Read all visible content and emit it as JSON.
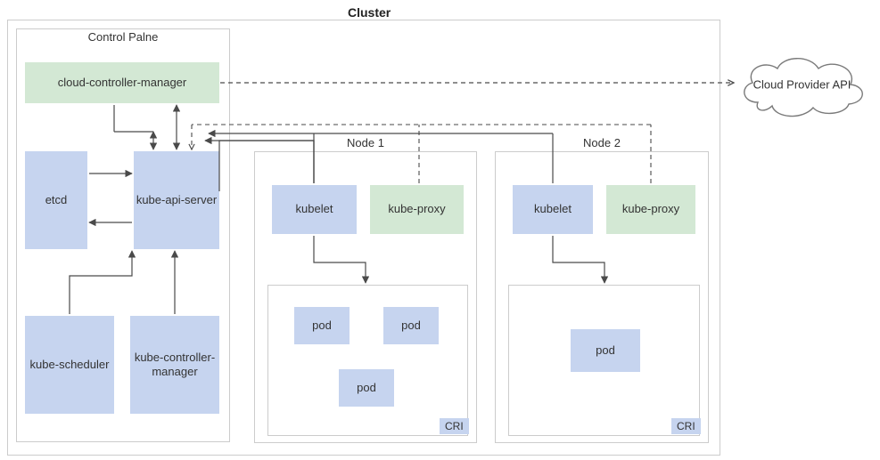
{
  "diagram": {
    "title": "Cluster",
    "cluster_frame": "",
    "control_plane": {
      "label": "Control Palne",
      "ccm": "cloud-controller-manager",
      "etcd": "etcd",
      "api": "kube-api-server",
      "scheduler": "kube-scheduler",
      "kcm": "kube-controller-manager"
    },
    "node1": {
      "label": "Node 1",
      "kubelet": "kubelet",
      "kubeproxy": "kube-proxy",
      "cri": "CRI",
      "pod1": "pod",
      "pod2": "pod",
      "pod3": "pod"
    },
    "node2": {
      "label": "Node 2",
      "kubelet": "kubelet",
      "kubeproxy": "kube-proxy",
      "cri": "CRI",
      "pod1": "pod"
    },
    "external": {
      "cloud_api": "Cloud Provider API"
    }
  }
}
